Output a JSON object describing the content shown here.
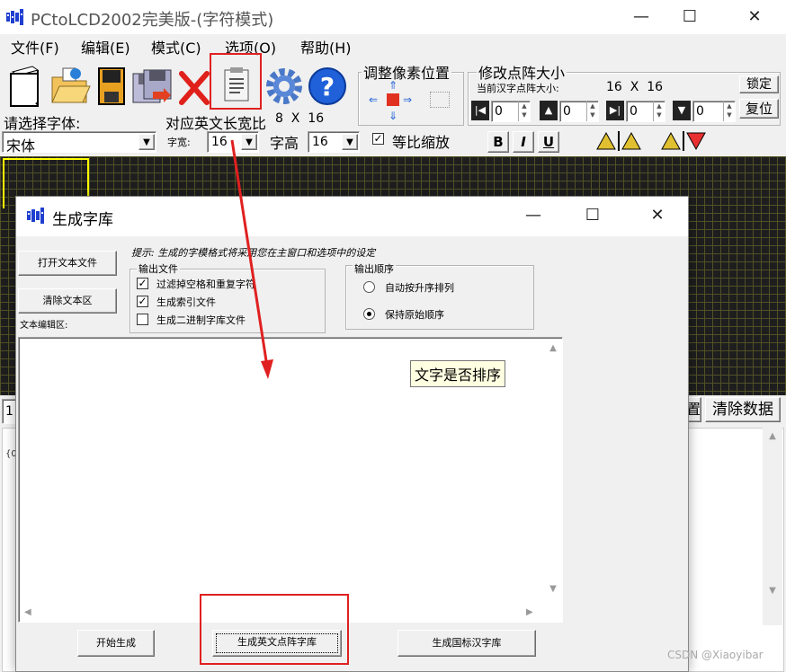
{
  "window": {
    "title": "PCtoLCD2002完美版-(字符模式)",
    "minimize": "—",
    "maximize": "☐",
    "close": "✕"
  },
  "menu": [
    "文件(F)",
    "编辑(E)",
    "模式(C)",
    "选项(O)",
    "帮助(H)"
  ],
  "adjust_group": {
    "label": "调整像素位置"
  },
  "matrix_group": {
    "label": "修改点阵大小",
    "current_label": "当前汉字点阵大小:",
    "current_value": "16  X  16",
    "lock": "锁定",
    "reset": "复位",
    "spin_values": [
      "0",
      "0",
      "0",
      "0"
    ]
  },
  "font_panel": {
    "select_font_label": "请选择字体:",
    "font_value": "宋体",
    "ratio_label": "对应英文长宽比",
    "ratio_value": "8  X  16",
    "width_label": "字宽:",
    "width_value": "16",
    "height_label": "字高",
    "height_value": "16",
    "scale_label": "等比缩放",
    "scale_checked": "✓",
    "bold": "B",
    "italic": "I",
    "underline": "U"
  },
  "main_bottom": {
    "left_partial": "1",
    "clear_data": "清除数据",
    "hidden_btn_partial": "置",
    "code_partial": "{0"
  },
  "dialog": {
    "title": "生成字库",
    "minimize": "—",
    "maximize": "☐",
    "close": "✕",
    "open_file": "打开文本文件",
    "clear_text": "清除文本区",
    "hint": "提示: 生成的字模格式将采用您在主窗口和选项中的设定",
    "text_area_label": "文本编辑区:",
    "output_file": {
      "label": "输出文件",
      "options": [
        {
          "label": "过滤掉空格和重复字符",
          "checked": "✓"
        },
        {
          "label": "生成索引文件",
          "checked": "✓"
        },
        {
          "label": "生成二进制字库文件",
          "checked": ""
        }
      ]
    },
    "output_order": {
      "label": "输出顺序",
      "options": [
        {
          "label": "自动按升序排列",
          "selected": false
        },
        {
          "label": "保持原始顺序",
          "selected": true
        }
      ]
    },
    "tooltip": "文字是否排序",
    "buttons": {
      "start": "开始生成",
      "english": "生成英文点阵字库",
      "gb": "生成国标汉字库"
    }
  },
  "watermark": "CSDN @Xiaoyibar",
  "colors": {
    "annotation_red": "#e02020",
    "grid_bg": "#1e1e1e",
    "grid_line": "#515126",
    "selection_yellow": "#ffff00",
    "tooltip_bg": "#ffffe1"
  }
}
